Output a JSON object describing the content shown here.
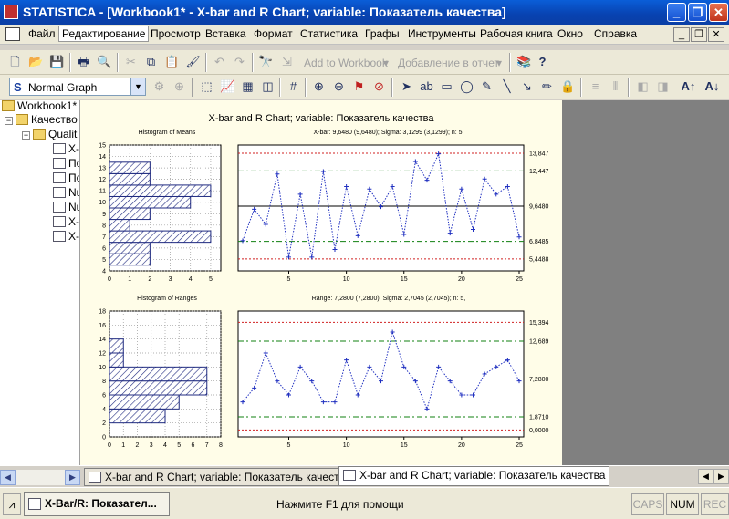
{
  "window": {
    "title": "STATISTICA - [Workbook1* - X-bar and R Chart; variable:  Показатель качества]",
    "min_label": "_",
    "max_label": "❐",
    "close_label": "✕"
  },
  "menu": {
    "items": [
      "Файл",
      "Редактирование",
      "Просмотр",
      "Вставка",
      "Формат",
      "Статистика",
      "Графы",
      "Инструменты",
      "Рабочая книга",
      "Окно",
      "Справка"
    ],
    "active_index": 1
  },
  "toolbar": {
    "add_to_workbook": "Add to Workbook",
    "add_to_report": "Добавление в отчет",
    "graph_style_prefix": "S",
    "graph_style_value": "Normal Graph"
  },
  "tree": {
    "root": "Workbook1*",
    "level1": "Качество",
    "level2": "Qualit",
    "items": [
      "X-",
      "По",
      "По",
      "Nu",
      "Nu",
      "X-",
      "X-"
    ],
    "item_icons": [
      "chart",
      "doc",
      "doc",
      "doc",
      "doc",
      "chart",
      "chart"
    ]
  },
  "chart_data": [
    {
      "type": "line",
      "title": "X-bar and R Chart; variable:  Показатель качества",
      "subtitle": "X-bar: 9,6480 (9,6480); Sigma: 3,1299 (3,1299); n: 5,",
      "x": [
        1,
        2,
        3,
        4,
        5,
        6,
        7,
        8,
        9,
        10,
        11,
        12,
        13,
        14,
        15,
        16,
        17,
        18,
        19,
        20,
        21,
        22,
        23,
        24,
        25
      ],
      "values": [
        6.9,
        9.4,
        8.2,
        12.2,
        5.6,
        10.6,
        5.6,
        12.4,
        6.2,
        11.2,
        7.3,
        11.0,
        9.6,
        11.2,
        7.4,
        13.2,
        11.7,
        13.8,
        7.5,
        11.0,
        7.8,
        11.8,
        10.6,
        11.2,
        7.2
      ],
      "xlim": [
        1,
        25
      ],
      "ylim": [
        4.5,
        14.5
      ],
      "xticks": [
        "5",
        "10",
        "15",
        "20",
        "25"
      ],
      "center_line": 9.648,
      "limit_lines": [
        13.847,
        12.447,
        6.8485,
        5.4488
      ],
      "right_labels": [
        "13,847",
        "12,447",
        "9,6480",
        "6,8485",
        "5,4488"
      ],
      "grid": false
    },
    {
      "type": "bar",
      "orientation": "horizontal",
      "title": "Histogram of Means",
      "categories": [
        5,
        6,
        7,
        8,
        9,
        10,
        11,
        12,
        13
      ],
      "values": [
        2,
        2,
        5,
        1,
        2,
        4,
        5,
        2,
        2
      ],
      "xticks": [
        "0",
        "1",
        "2",
        "3",
        "4",
        "5"
      ],
      "yticks": [
        "4",
        "5",
        "6",
        "7",
        "8",
        "9",
        "10",
        "11",
        "12",
        "13",
        "14",
        "15"
      ],
      "xlim": [
        0,
        5.5
      ],
      "ylim": [
        4,
        15
      ],
      "grid": true
    },
    {
      "type": "line",
      "title": "Range: 7,2800 (7,2800); Sigma: 2,7045 (2,7045); n: 5,",
      "x": [
        1,
        2,
        3,
        4,
        5,
        6,
        7,
        8,
        9,
        10,
        11,
        12,
        13,
        14,
        15,
        16,
        17,
        18,
        19,
        20,
        21,
        22,
        23,
        24,
        25
      ],
      "values": [
        4,
        6,
        11,
        7,
        5,
        9,
        7,
        4,
        4,
        10,
        5,
        9,
        7,
        14,
        9,
        7,
        3,
        9,
        7,
        5,
        5,
        8,
        9,
        10,
        7
      ],
      "xlim": [
        1,
        25
      ],
      "ylim": [
        -1,
        17
      ],
      "xticks": [
        "5",
        "10",
        "15",
        "20",
        "25"
      ],
      "center_line": 7.28,
      "limit_lines": [
        15.394,
        12.689,
        1.871,
        0
      ],
      "right_labels": [
        "15,394",
        "12,689",
        "7,2800",
        "1,8710",
        "0,0000"
      ],
      "grid": false
    },
    {
      "type": "bar",
      "orientation": "horizontal",
      "title": "Histogram of Ranges",
      "categories": [
        3,
        5,
        7,
        9,
        11,
        13
      ],
      "values": [
        4,
        5,
        7,
        7,
        1,
        1
      ],
      "xticks": [
        "0",
        "1",
        "2",
        "3",
        "4",
        "5",
        "6",
        "7",
        "8"
      ],
      "yticks": [
        "0",
        "2",
        "4",
        "6",
        "8",
        "10",
        "12",
        "14",
        "16",
        "18"
      ],
      "xlim": [
        0,
        8
      ],
      "ylim": [
        0,
        18
      ],
      "grid": true
    }
  ],
  "tabs": [
    "X-bar and R Chart; variable:  Показатель качества",
    "X-bar and R Chart; variable:  Показатель качества"
  ],
  "status": {
    "task": "X-Bar/R: Показател...",
    "help": "Нажмите F1 для помощи",
    "caps": "CAPS",
    "num": "NUM",
    "rec": "REC"
  }
}
